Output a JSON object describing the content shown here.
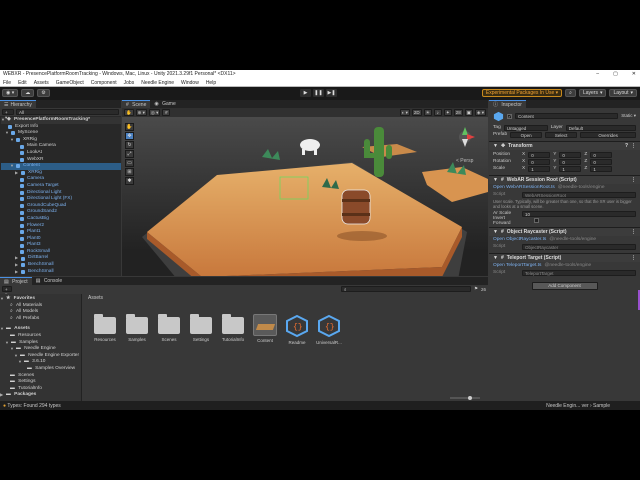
{
  "window": {
    "title": "WEBXR - PresencePlatformRoomTracking - Windows, Mac, Linux - Unity 2021.3.29f1 Personal* <DX11>",
    "min": "–",
    "max": "▢",
    "close": "✕"
  },
  "menu": [
    "File",
    "Edit",
    "Assets",
    "GameObject",
    "Component",
    "Jobs",
    "Needle Engine",
    "Window",
    "Help"
  ],
  "toolbar": {
    "experimental": "Experimental Packages In Use ▾",
    "layers": "Layers",
    "layout": "Layout"
  },
  "hierarchy": {
    "tab": "Hierarchy",
    "search_placeholder": "All",
    "scene_root": "PresencePlatformRoomTracking*",
    "items": [
      {
        "label": "Export Info"
      },
      {
        "label": "MyScene"
      },
      {
        "label": "XRRig"
      },
      {
        "label": "Main Camera"
      },
      {
        "label": "LookAt"
      },
      {
        "label": "WebXR"
      },
      {
        "label": "Content"
      },
      {
        "label": "XRRig"
      },
      {
        "label": "Camera"
      },
      {
        "label": "Camera Target"
      },
      {
        "label": "Directional Light"
      },
      {
        "label": "Directional Light (FX)"
      },
      {
        "label": "GroundCubeQuad"
      },
      {
        "label": "GroundSand2"
      },
      {
        "label": "CactusBig"
      },
      {
        "label": "Flower2"
      },
      {
        "label": "Plant1"
      },
      {
        "label": "Plant0"
      },
      {
        "label": "Plant3"
      },
      {
        "label": "RockSmall"
      },
      {
        "label": "DirtBarrel"
      },
      {
        "label": "BenchSmall"
      },
      {
        "label": "BenchSmall"
      }
    ]
  },
  "scene": {
    "tabs": [
      "Scene",
      "Game"
    ],
    "persp": "< Persp",
    "count": "28"
  },
  "project": {
    "tabs": [
      "Project",
      "Console"
    ],
    "favorites_label": "Favorites",
    "favorites": [
      "All Materials",
      "All Models",
      "All Prefabs"
    ],
    "assets_label": "Assets",
    "assets_tree": [
      "Resources",
      "Samples",
      "Needle Engine",
      "Needle Engine Exporter",
      "3.6.10",
      "Samples Overview",
      "Scenes",
      "Settings",
      "TutorialInfo"
    ],
    "packages_label": "Packages",
    "breadcrumb": "Assets",
    "grid": [
      {
        "label": "Resources",
        "kind": "folder"
      },
      {
        "label": "Samples",
        "kind": "folder"
      },
      {
        "label": "Scenes",
        "kind": "folder"
      },
      {
        "label": "Settings",
        "kind": "folder"
      },
      {
        "label": "TutorialInfo",
        "kind": "folder"
      },
      {
        "label": "Content",
        "kind": "prefab"
      },
      {
        "label": "Readme",
        "kind": "script"
      },
      {
        "label": "UniversalR...",
        "kind": "script"
      }
    ],
    "count": "26"
  },
  "inspector": {
    "tab": "Inspector",
    "object_name": "Content",
    "static": "Static ▾",
    "tag_label": "Tag",
    "tag_value": "Untagged",
    "layer_label": "Layer",
    "layer_value": "Default",
    "prefab_label": "Prefab",
    "prefab_buttons": [
      "Open",
      "Select",
      "Overrides"
    ],
    "transform": {
      "title": "Transform",
      "rows": [
        {
          "label": "Position",
          "x": "0",
          "y": "0",
          "z": "0"
        },
        {
          "label": "Rotation",
          "x": "0",
          "y": "0",
          "z": "0"
        },
        {
          "label": "Scale",
          "x": "1",
          "y": "1",
          "z": "1"
        }
      ]
    },
    "webar": {
      "title": "WebAR Session Root (Script)",
      "open": "Open WebARSessionRoot.ts",
      "pkg": "@needle-tools/engine",
      "script_label": "Script",
      "script_value": "WebARSessionRoot",
      "desc": "User scale. Typically, will be greater than one, so that the XR user is bigger and looks at a small scene.",
      "ar_scale_label": "Ar Scale",
      "ar_scale_value": "10",
      "invert": "Invert Forward"
    },
    "raycaster": {
      "title": "Object Raycaster (Script)",
      "open": "Open ObjectRaycaster.ts",
      "pkg": "@needle-tools/engine",
      "script_label": "Script",
      "script_value": "ObjectRaycaster"
    },
    "teleport": {
      "title": "Teleport Target (Script)",
      "open": "Open TeleportTarget.ts",
      "pkg": "@needle-tools/engine",
      "script_label": "Script",
      "script_value": "TeleportTarget"
    },
    "add_component": "Add Component"
  },
  "status": {
    "left": "Types: Found 294 types",
    "right": "Needle Engin... ver › Sample"
  },
  "colors": {
    "accent": "#4a90e2",
    "selection": "#2c5d87",
    "warning": "#f0a030",
    "ground": "#e0a460"
  }
}
